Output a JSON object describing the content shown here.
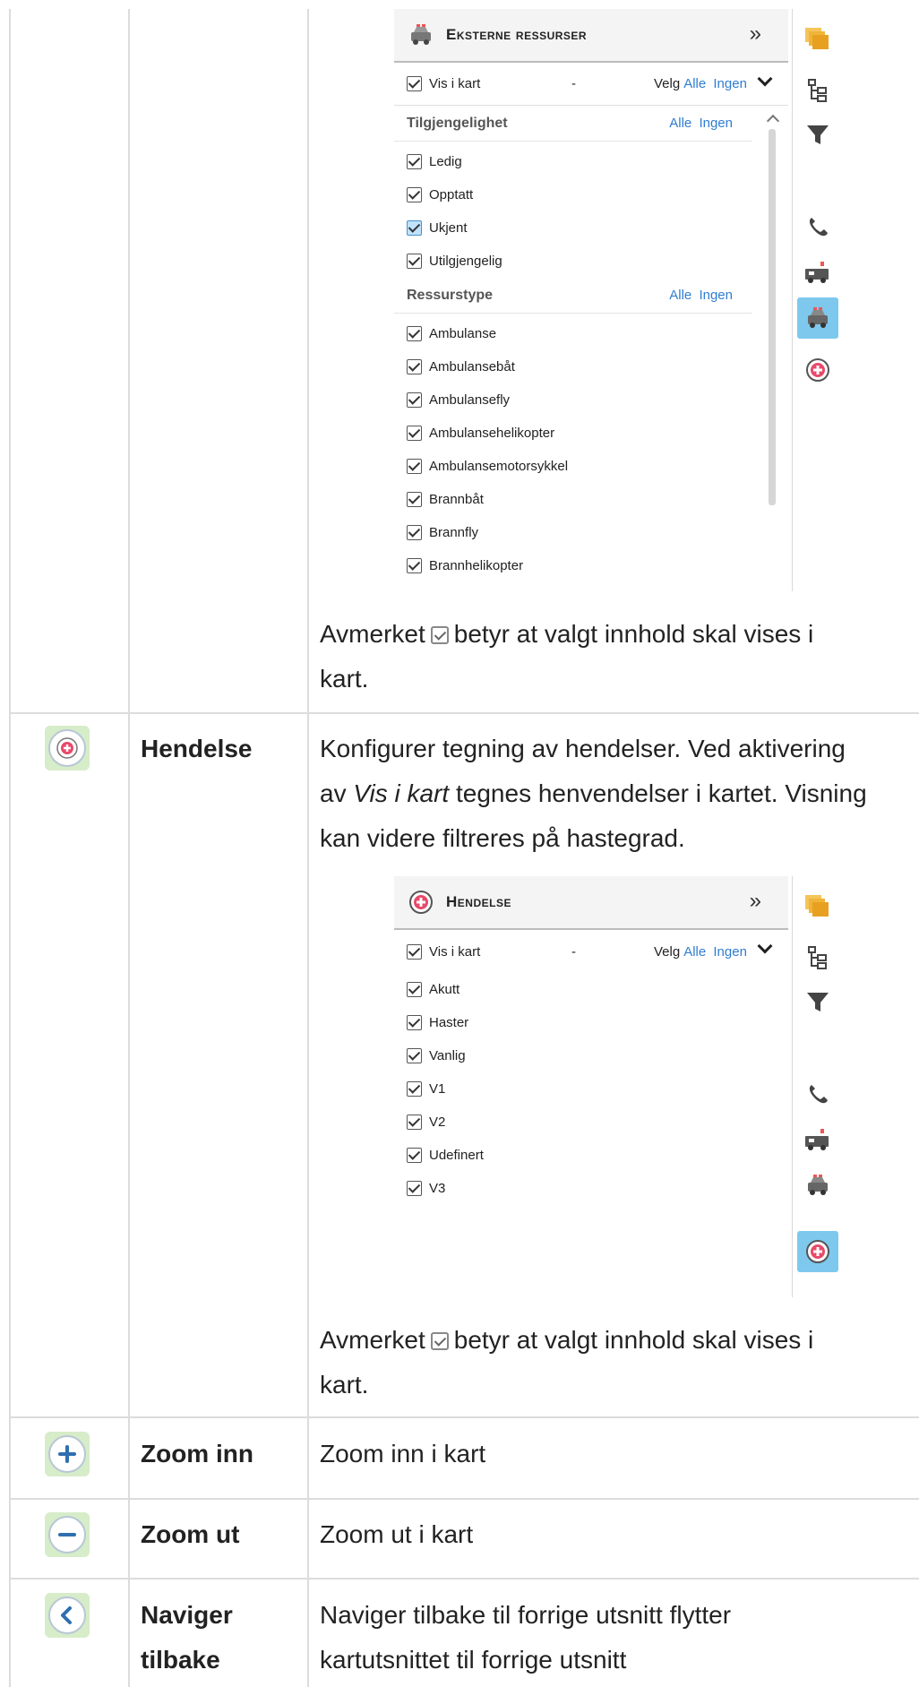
{
  "panel_ext": {
    "title": "Eksterne ressurser",
    "collapse": "»",
    "vis_label": "Vis i kart",
    "dash": "-",
    "velg": "Velg",
    "alle": "Alle",
    "ingen": "Ingen",
    "sections": [
      {
        "title": "Tilgjengelighet",
        "items": [
          "Ledig",
          "Opptatt",
          "Ukjent",
          "Utilgjengelig"
        ]
      },
      {
        "title": "Ressurstype",
        "items": [
          "Ambulanse",
          "Ambulansebåt",
          "Ambulansefly",
          "Ambulansehelikopter",
          "Ambulansemotorsykkel",
          "Brannbåt",
          "Brannfly",
          "Brannhelikopter"
        ]
      }
    ]
  },
  "note": {
    "before": "Avmerket",
    "after": "betyr at valgt innhold skal vises i",
    "line2": "kart."
  },
  "rows": {
    "hendelse": {
      "name": "Hendelse",
      "desc_p1": "Konfigurer tegning av hendelser. Ved aktivering",
      "desc_p2a": "av",
      "desc_p2em": "Vis i kart",
      "desc_p2b": "tegnes henvendelser i kartet. Visning",
      "desc_p3": "kan videre filtreres på hastegrad."
    },
    "zoom_inn": {
      "name": "Zoom inn",
      "desc": "Zoom inn i kart"
    },
    "zoom_ut": {
      "name": "Zoom ut",
      "desc": "Zoom ut i kart"
    },
    "naviger": {
      "name_1": "Naviger",
      "name_2": "tilbake",
      "desc_1": "Naviger tilbake til forrige utsnitt flytter",
      "desc_2": "kartutsnittet til forrige utsnitt"
    }
  },
  "panel_hend": {
    "title": "Hendelse",
    "collapse": "»",
    "vis_label": "Vis i kart",
    "dash": "-",
    "velg": "Velg",
    "alle": "Alle",
    "ingen": "Ingen",
    "items": [
      "Akutt",
      "Haster",
      "Vanlig",
      "V1",
      "V2",
      "Udefinert",
      "V3"
    ]
  },
  "colors": {
    "accent": "#2f7dd1",
    "active_side": "#7ec8ee",
    "map_green": "#d7ecc9"
  }
}
